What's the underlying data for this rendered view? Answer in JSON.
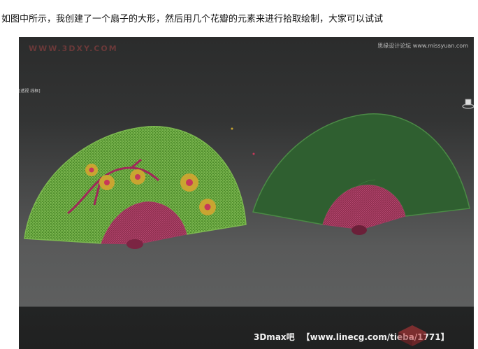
{
  "caption": "如图中所示，我创建了一个扇子的大形，然后用几个花瓣的元素来进行拾取绘制，大家可以试试",
  "viewport": {
    "watermark_left": "WWW.3DXY.COM",
    "watermark_right": "思缘设计论坛 www.missyuan.com",
    "label": "[透视 线框]",
    "brand_left": "3Dmax吧",
    "brand_right": "【www.linecg.com/tieba/1771】",
    "logo_icon": "3d-box-logo-icon",
    "colors": {
      "fan_leaf_left": "#4f8a2e",
      "fan_leaf_right": "#2f5f30",
      "fan_ribs": "#8d2e4e",
      "flower": "#c9a531",
      "branch": "#a0285a"
    }
  }
}
